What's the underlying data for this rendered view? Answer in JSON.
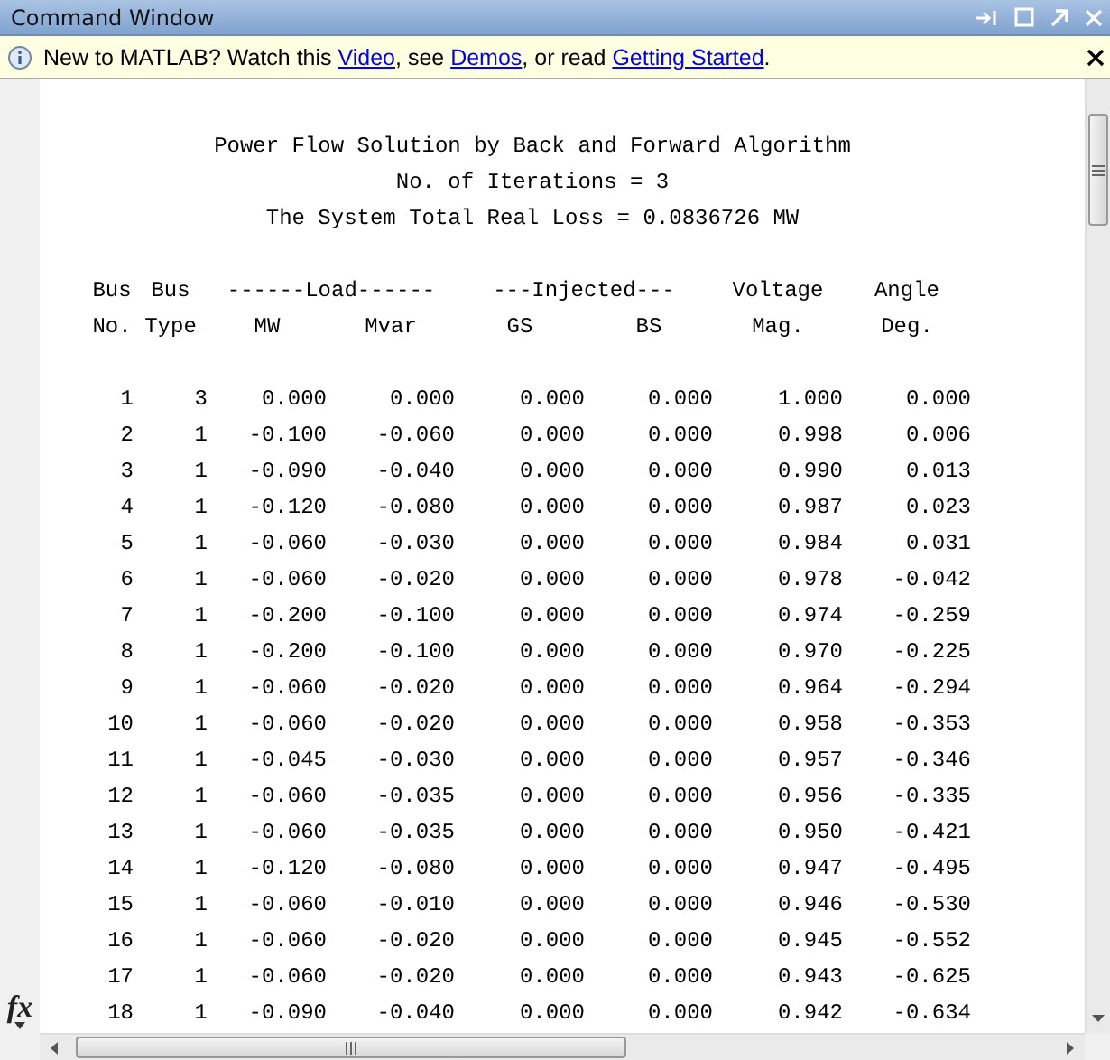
{
  "window": {
    "title": "Command Window"
  },
  "info_bar": {
    "parts": [
      {
        "kind": "text",
        "text": "New to MATLAB? Watch this "
      },
      {
        "kind": "link",
        "text": "Video"
      },
      {
        "kind": "text",
        "text": ", see "
      },
      {
        "kind": "link",
        "text": "Demos"
      },
      {
        "kind": "text",
        "text": ", or read "
      },
      {
        "kind": "link",
        "text": "Getting Started"
      },
      {
        "kind": "text",
        "text": "."
      }
    ]
  },
  "prompt_label": "fx",
  "report": {
    "title_lines": [
      "Power Flow Solution by Back and Forward Algorithm",
      "No. of Iterations = 3",
      "The System Total Real Loss = 0.0836726 MW"
    ],
    "group_headers": [
      {
        "text": "Bus",
        "kind": "single"
      },
      {
        "text": "Bus",
        "kind": "single"
      },
      {
        "text": "------Load------",
        "kind": "group"
      },
      {
        "text": "---Injected---",
        "kind": "group"
      },
      {
        "text": "Voltage",
        "kind": "single"
      },
      {
        "text": "Angle",
        "kind": "single"
      }
    ],
    "columns": [
      "No.",
      "Type",
      "MW",
      "Mvar",
      "GS",
      "BS",
      "Mag.",
      "Deg."
    ],
    "rows": [
      [
        "1",
        "3",
        "0.000",
        "0.000",
        "0.000",
        "0.000",
        "1.000",
        "0.000"
      ],
      [
        "2",
        "1",
        "-0.100",
        "-0.060",
        "0.000",
        "0.000",
        "0.998",
        "0.006"
      ],
      [
        "3",
        "1",
        "-0.090",
        "-0.040",
        "0.000",
        "0.000",
        "0.990",
        "0.013"
      ],
      [
        "4",
        "1",
        "-0.120",
        "-0.080",
        "0.000",
        "0.000",
        "0.987",
        "0.023"
      ],
      [
        "5",
        "1",
        "-0.060",
        "-0.030",
        "0.000",
        "0.000",
        "0.984",
        "0.031"
      ],
      [
        "6",
        "1",
        "-0.060",
        "-0.020",
        "0.000",
        "0.000",
        "0.978",
        "-0.042"
      ],
      [
        "7",
        "1",
        "-0.200",
        "-0.100",
        "0.000",
        "0.000",
        "0.974",
        "-0.259"
      ],
      [
        "8",
        "1",
        "-0.200",
        "-0.100",
        "0.000",
        "0.000",
        "0.970",
        "-0.225"
      ],
      [
        "9",
        "1",
        "-0.060",
        "-0.020",
        "0.000",
        "0.000",
        "0.964",
        "-0.294"
      ],
      [
        "10",
        "1",
        "-0.060",
        "-0.020",
        "0.000",
        "0.000",
        "0.958",
        "-0.353"
      ],
      [
        "11",
        "1",
        "-0.045",
        "-0.030",
        "0.000",
        "0.000",
        "0.957",
        "-0.346"
      ],
      [
        "12",
        "1",
        "-0.060",
        "-0.035",
        "0.000",
        "0.000",
        "0.956",
        "-0.335"
      ],
      [
        "13",
        "1",
        "-0.060",
        "-0.035",
        "0.000",
        "0.000",
        "0.950",
        "-0.421"
      ],
      [
        "14",
        "1",
        "-0.120",
        "-0.080",
        "0.000",
        "0.000",
        "0.947",
        "-0.495"
      ],
      [
        "15",
        "1",
        "-0.060",
        "-0.010",
        "0.000",
        "0.000",
        "0.946",
        "-0.530"
      ],
      [
        "16",
        "1",
        "-0.060",
        "-0.020",
        "0.000",
        "0.000",
        "0.945",
        "-0.552"
      ],
      [
        "17",
        "1",
        "-0.060",
        "-0.020",
        "0.000",
        "0.000",
        "0.943",
        "-0.625"
      ],
      [
        "18",
        "1",
        "-0.090",
        "-0.040",
        "0.000",
        "0.000",
        "0.942",
        "-0.634"
      ]
    ]
  }
}
